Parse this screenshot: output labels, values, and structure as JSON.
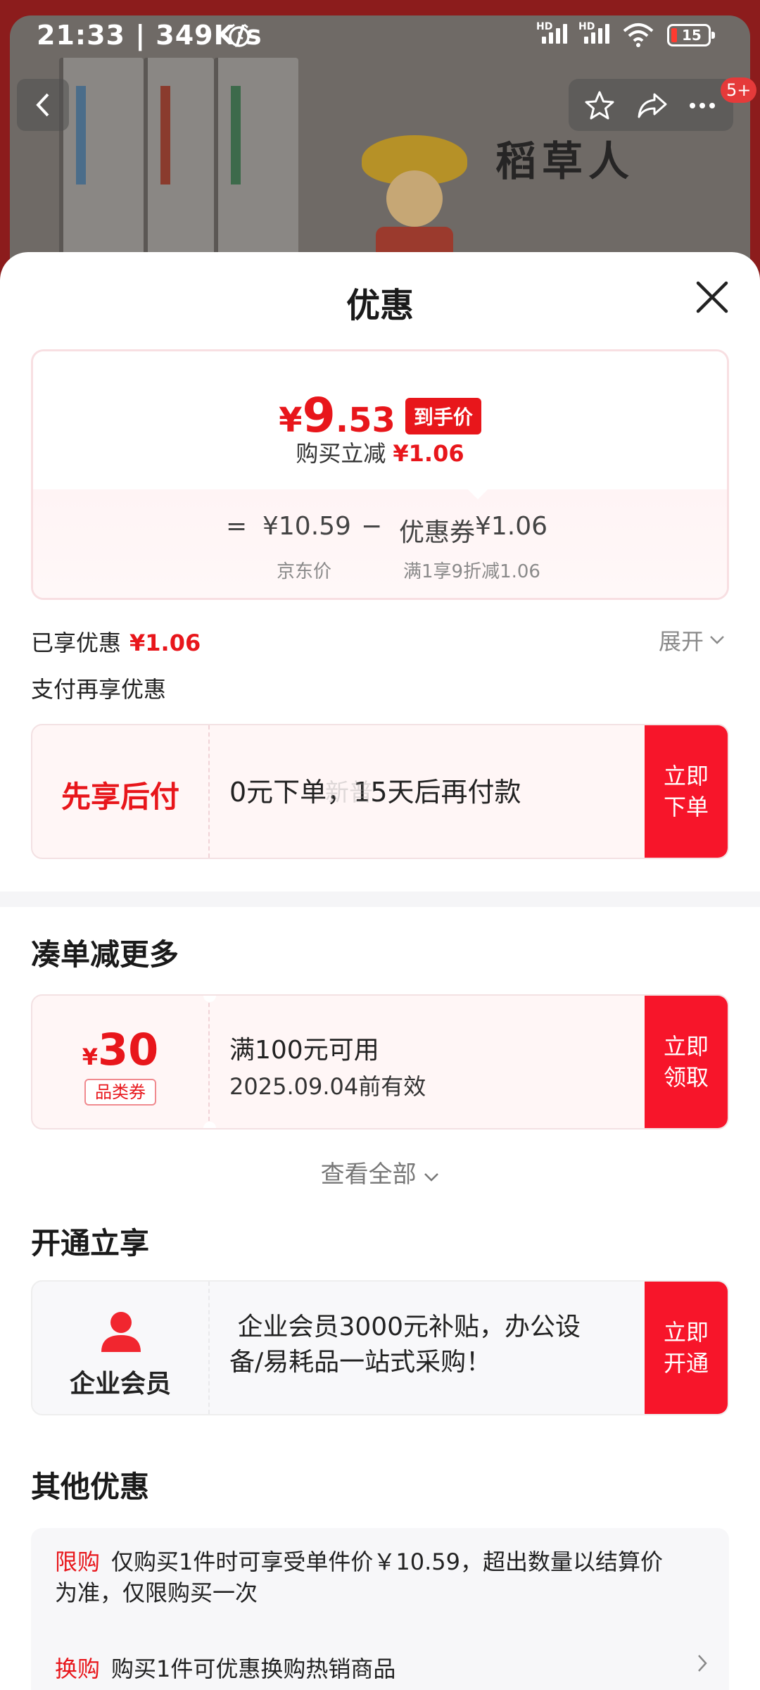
{
  "status_bar": {
    "time": "21:33 | 349K/s",
    "battery": "15",
    "hd1": "HD",
    "hd2": "HD"
  },
  "product_bg": {
    "book_title": "稻草人"
  },
  "nav": {
    "cart_badge": "5+"
  },
  "sheet": {
    "title": "优惠",
    "price": {
      "yen": "¥",
      "int": "9",
      "dec": ".53",
      "tag": "到手价",
      "lijian_label": "购买立减",
      "lijian_value": "¥1.06",
      "eq_sign": "=",
      "jd_price": "¥10.59",
      "minus": "−",
      "coupon_label": "优惠券",
      "coupon_value": "¥1.06",
      "jd_price_label": "京东价",
      "coupon_desc": "满1享9折减1.06"
    },
    "enjoyed": {
      "label": "已享优惠",
      "value": "¥1.06",
      "expand": "展开"
    },
    "pay_again": "支付再享优惠",
    "pay_later": {
      "title": "先享后付",
      "text": "0元下单，15天后再付款",
      "cta_line1": "立即",
      "cta_line2": "下单",
      "watermark": "新普"
    },
    "more": {
      "section_title": "凑单减更多",
      "coupon": {
        "yen": "¥",
        "amount": "30",
        "type": "品类券",
        "condition": "满100元可用",
        "expiry": "2025.09.04前有效",
        "cta_line1": "立即",
        "cta_line2": "领取"
      },
      "view_all": "查看全部"
    },
    "open": {
      "section_title": "开通立享",
      "member_label": "企业会员",
      "text_line1": " 企业会员3000元补贴，办公设",
      "text_line2": "备/易耗品一站式采购！",
      "cta_line1": "立即",
      "cta_line2": "开通"
    },
    "other": {
      "section_title": "其他优惠",
      "items": [
        {
          "tag": "限购",
          "text_line1": "仅购买1件时可享受单件价￥10.59，超出数量以结算价",
          "text_line2": "为准，仅限购买一次"
        },
        {
          "tag": "换购",
          "text_line1": "购买1件可优惠换购热销商品"
        }
      ]
    }
  },
  "colors": {
    "accent_red": "#e8161b",
    "cta_red": "#f7152a",
    "card_pink": "#fff6f6"
  }
}
